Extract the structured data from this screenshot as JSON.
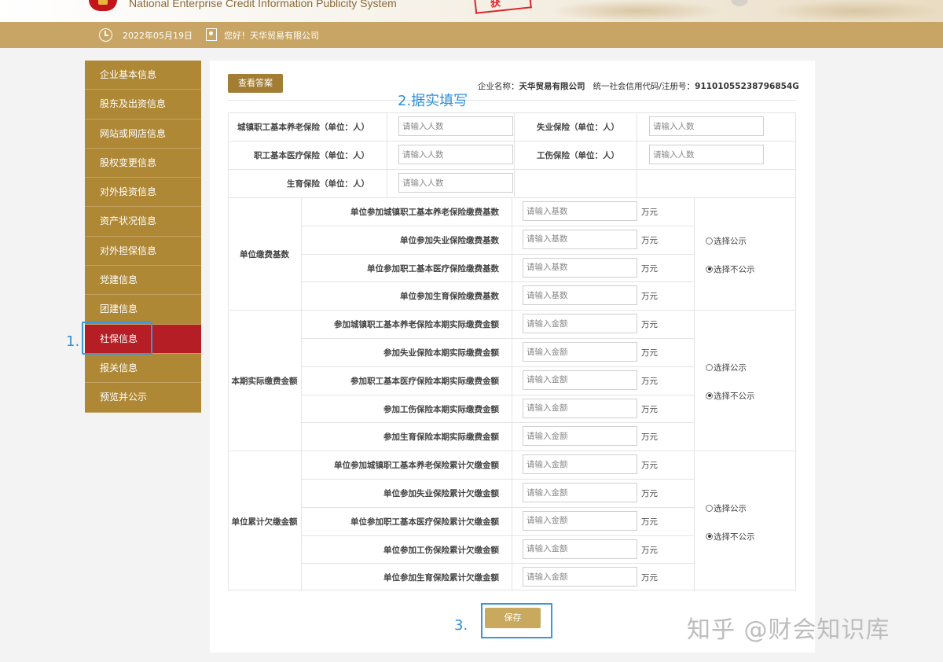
{
  "header": {
    "title_en": "National Enterprise Credit Information Publicity System",
    "stamp_text": "获",
    "date": "2022年05月19日",
    "greeting": "您好！天华贸易有限公司"
  },
  "sidebar": {
    "items": [
      {
        "label": "企业基本信息"
      },
      {
        "label": "股东及出资信息"
      },
      {
        "label": "网站或网店信息"
      },
      {
        "label": "股权变更信息"
      },
      {
        "label": "对外投资信息"
      },
      {
        "label": "资产状况信息"
      },
      {
        "label": "对外担保信息"
      },
      {
        "label": "党建信息"
      },
      {
        "label": "团建信息"
      },
      {
        "label": "社保信息",
        "active": true
      },
      {
        "label": "报关信息"
      },
      {
        "label": "预览并公示"
      }
    ]
  },
  "annotations": {
    "step1": "1.",
    "step2": "2.据实填写",
    "step3": "3."
  },
  "toolbar": {
    "view_answer_label": "查看答案"
  },
  "company_info": {
    "name_label": "企业名称：",
    "name": "天华贸易有限公司",
    "code_label": "统一社会信用代码/注册号：",
    "code": "91101055238796854G"
  },
  "insured": {
    "rows": [
      {
        "left_label": "城镇职工基本养老保险（单位：人）",
        "left_placeholder": "请输入人数",
        "right_label": "失业保险（单位：人）",
        "right_placeholder": "请输入人数"
      },
      {
        "left_label": "职工基本医疗保险（单位：人）",
        "left_placeholder": "请输入人数",
        "right_label": "工伤保险（单位：人）",
        "right_placeholder": "请输入人数"
      },
      {
        "left_label": "生育保险（单位：人）",
        "left_placeholder": "请输入人数"
      }
    ]
  },
  "groups": [
    {
      "title": "单位缴费基数",
      "option_public": "选择公示",
      "option_private": "选择不公示",
      "selected": "private",
      "rows": [
        {
          "label": "单位参加城镇职工基本养老保险缴费基数",
          "placeholder": "请输入基数",
          "unit": "万元"
        },
        {
          "label": "单位参加失业保险缴费基数",
          "placeholder": "请输入基数",
          "unit": "万元"
        },
        {
          "label": "单位参加职工基本医疗保险缴费基数",
          "placeholder": "请输入基数",
          "unit": "万元"
        },
        {
          "label": "单位参加生育保险缴费基数",
          "placeholder": "请输入基数",
          "unit": "万元"
        }
      ]
    },
    {
      "title": "本期实际缴费金额",
      "option_public": "选择公示",
      "option_private": "选择不公示",
      "selected": "private",
      "rows": [
        {
          "label": "参加城镇职工基本养老保险本期实际缴费金额",
          "placeholder": "请输入金额",
          "unit": "万元"
        },
        {
          "label": "参加失业保险本期实际缴费金额",
          "placeholder": "请输入金额",
          "unit": "万元"
        },
        {
          "label": "参加职工基本医疗保险本期实际缴费金额",
          "placeholder": "请输入金额",
          "unit": "万元"
        },
        {
          "label": "参加工伤保险本期实际缴费金额",
          "placeholder": "请输入金额",
          "unit": "万元"
        },
        {
          "label": "参加生育保险本期实际缴费金额",
          "placeholder": "请输入金额",
          "unit": "万元"
        }
      ]
    },
    {
      "title": "单位累计欠缴金额",
      "option_public": "选择公示",
      "option_private": "选择不公示",
      "selected": "private",
      "rows": [
        {
          "label": "单位参加城镇职工基本养老保险累计欠缴金额",
          "placeholder": "请输入金额",
          "unit": "万元"
        },
        {
          "label": "单位参加失业保险累计欠缴金额",
          "placeholder": "请输入金额",
          "unit": "万元"
        },
        {
          "label": "单位参加职工基本医疗保险累计欠缴金额",
          "placeholder": "请输入金额",
          "unit": "万元"
        },
        {
          "label": "单位参加工伤保险累计欠缴金额",
          "placeholder": "请输入金额",
          "unit": "万元"
        },
        {
          "label": "单位参加生育保险累计欠缴金额",
          "placeholder": "请输入金额",
          "unit": "万元"
        }
      ]
    }
  ],
  "footer": {
    "save_label": "保存",
    "watermark": "知乎 @财会知识库"
  },
  "colors": {
    "gold_bar": "#c8a564",
    "sidebar": "#af8836",
    "sidebar_active": "#b51e24",
    "annotation_blue": "#3a96dd"
  }
}
